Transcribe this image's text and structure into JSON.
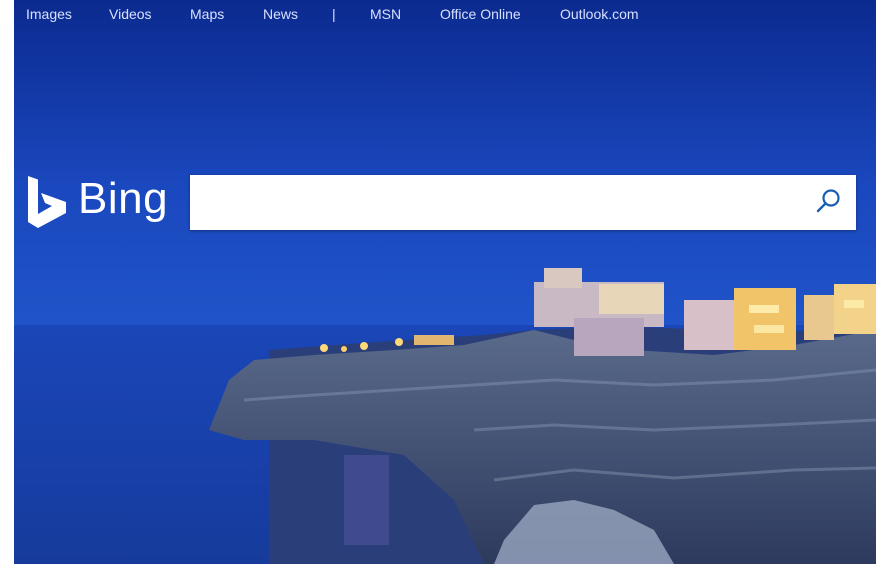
{
  "nav": {
    "items": [
      {
        "label": "Images"
      },
      {
        "label": "Videos"
      },
      {
        "label": "Maps"
      },
      {
        "label": "News"
      },
      {
        "label": "MSN"
      },
      {
        "label": "Office Online"
      },
      {
        "label": "Outlook.com"
      }
    ],
    "separator": "|"
  },
  "logo": {
    "text": "Bing",
    "icon": "bing-b-icon"
  },
  "search": {
    "value": "",
    "placeholder": "",
    "button_icon": "search-icon"
  },
  "colors": {
    "accent": "#ffffff",
    "sky": "#1744b8",
    "nav_text": "#d7e0ff"
  }
}
